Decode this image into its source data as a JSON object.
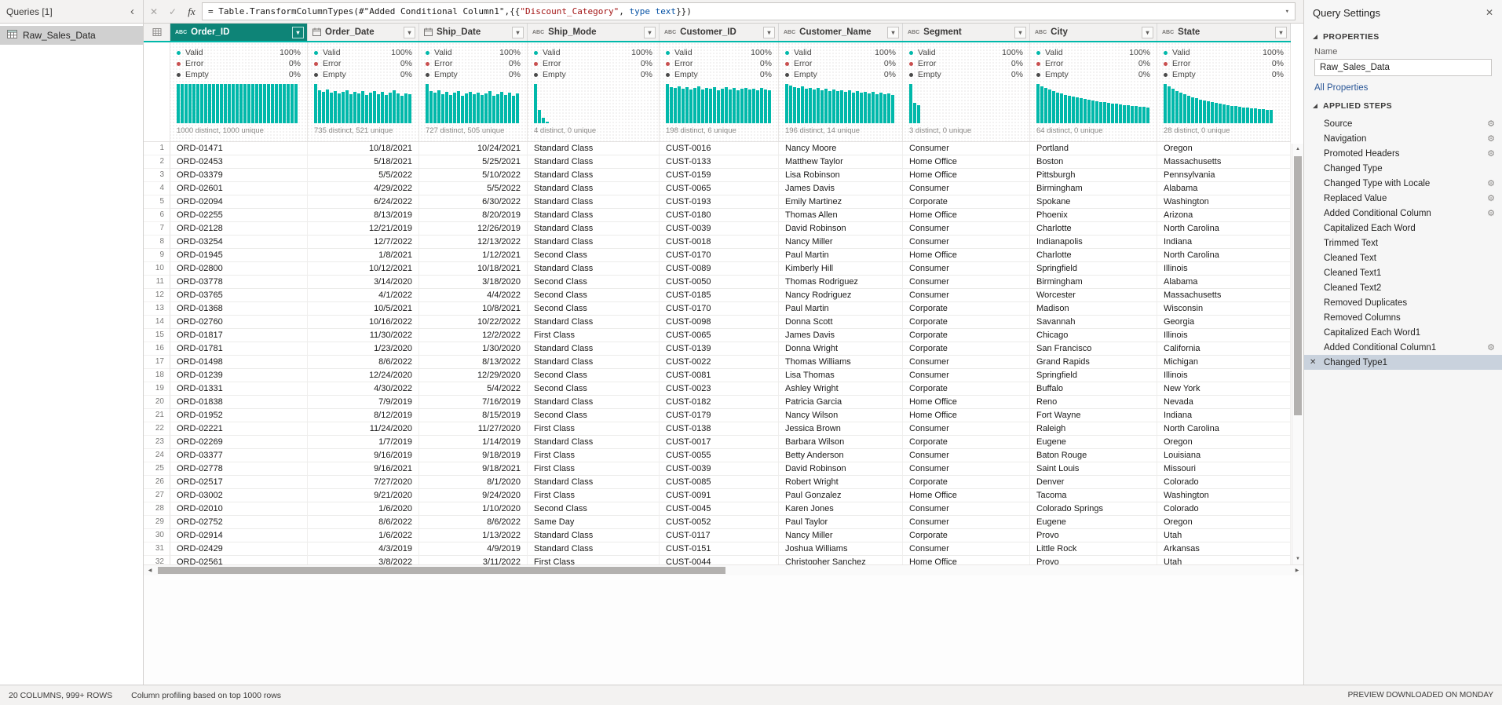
{
  "accent": "#01b8aa",
  "queries_pane": {
    "title": "Queries [1]",
    "items": [
      {
        "label": "Raw_Sales_Data",
        "selected": true
      }
    ]
  },
  "formula_bar": {
    "tokens": [
      {
        "text": "= Table.TransformColumnTypes(#\"Added Conditional Column1\",{{",
        "style": "plain"
      },
      {
        "text": "\"Discount_Category\"",
        "style": "string"
      },
      {
        "text": ", ",
        "style": "plain"
      },
      {
        "text": "type text",
        "style": "keyword"
      },
      {
        "text": "}})",
        "style": "plain"
      }
    ]
  },
  "table": {
    "quality_labels": {
      "valid": "Valid",
      "error": "Error",
      "empty": "Empty"
    },
    "columns": [
      {
        "name": "Order_ID",
        "type": "text",
        "selected": true,
        "quality": {
          "valid": "100%",
          "error": "0%",
          "empty": "0%"
        },
        "distinct_label": "1000 distinct, 1000 unique",
        "histogram": [
          1,
          1,
          1,
          1,
          1,
          1,
          1,
          1,
          1,
          1,
          1,
          1,
          1,
          1,
          1,
          1,
          1,
          1,
          1,
          1,
          1,
          1,
          1,
          1,
          1,
          1,
          1,
          1,
          1,
          1,
          1
        ]
      },
      {
        "name": "Order_Date",
        "type": "date",
        "selected": false,
        "quality": {
          "valid": "100%",
          "error": "0%",
          "empty": "0%"
        },
        "distinct_label": "735 distinct, 521 unique",
        "histogram": [
          1,
          0.84,
          0.8,
          0.86,
          0.78,
          0.83,
          0.76,
          0.81,
          0.85,
          0.74,
          0.8,
          0.77,
          0.83,
          0.72,
          0.78,
          0.82,
          0.75,
          0.8,
          0.73,
          0.79,
          0.84,
          0.76,
          0.71,
          0.77,
          0.74
        ]
      },
      {
        "name": "Ship_Date",
        "type": "date",
        "selected": false,
        "quality": {
          "valid": "100%",
          "error": "0%",
          "empty": "0%"
        },
        "distinct_label": "727 distinct, 505 unique",
        "histogram": [
          1,
          0.82,
          0.78,
          0.84,
          0.75,
          0.8,
          0.73,
          0.79,
          0.83,
          0.71,
          0.77,
          0.81,
          0.74,
          0.79,
          0.72,
          0.76,
          0.82,
          0.7,
          0.75,
          0.8,
          0.73,
          0.78,
          0.71,
          0.76
        ]
      },
      {
        "name": "Ship_Mode",
        "type": "text",
        "selected": false,
        "quality": {
          "valid": "100%",
          "error": "0%",
          "empty": "0%"
        },
        "distinct_label": "4 distinct, 0 unique",
        "histogram": [
          1,
          0.34,
          0.15,
          0.05
        ]
      },
      {
        "name": "Customer_ID",
        "type": "text",
        "selected": false,
        "quality": {
          "valid": "100%",
          "error": "0%",
          "empty": "0%"
        },
        "distinct_label": "198 distinct, 6 unique",
        "histogram": [
          1,
          0.93,
          0.9,
          0.95,
          0.88,
          0.92,
          0.87,
          0.91,
          0.94,
          0.86,
          0.9,
          0.88,
          0.92,
          0.85,
          0.89,
          0.93,
          0.87,
          0.9,
          0.84,
          0.88,
          0.91,
          0.86,
          0.89,
          0.85,
          0.9,
          0.87,
          0.84
        ]
      },
      {
        "name": "Customer_Name",
        "type": "text",
        "selected": false,
        "quality": {
          "valid": "100%",
          "error": "0%",
          "empty": "0%"
        },
        "distinct_label": "196 distinct, 14 unique",
        "histogram": [
          1,
          0.96,
          0.93,
          0.9,
          0.94,
          0.88,
          0.91,
          0.86,
          0.9,
          0.84,
          0.88,
          0.83,
          0.87,
          0.82,
          0.85,
          0.8,
          0.84,
          0.79,
          0.82,
          0.78,
          0.81,
          0.76,
          0.8,
          0.75,
          0.78,
          0.74,
          0.77,
          0.73
        ]
      },
      {
        "name": "Segment",
        "type": "text",
        "selected": false,
        "quality": {
          "valid": "100%",
          "error": "0%",
          "empty": "0%"
        },
        "distinct_label": "3 distinct, 0 unique",
        "histogram": [
          1,
          0.52,
          0.46
        ]
      },
      {
        "name": "City",
        "type": "text",
        "selected": false,
        "quality": {
          "valid": "100%",
          "error": "0%",
          "empty": "0%"
        },
        "distinct_label": "64 distinct, 0 unique",
        "histogram": [
          1,
          0.95,
          0.9,
          0.86,
          0.82,
          0.79,
          0.76,
          0.73,
          0.7,
          0.68,
          0.66,
          0.64,
          0.62,
          0.6,
          0.58,
          0.57,
          0.55,
          0.54,
          0.52,
          0.51,
          0.5,
          0.48,
          0.47,
          0.46,
          0.45,
          0.44,
          0.43,
          0.42,
          0.41
        ]
      },
      {
        "name": "State",
        "type": "text",
        "selected": false,
        "quality": {
          "valid": "100%",
          "error": "0%",
          "empty": "0%"
        },
        "distinct_label": "28 distinct, 0 unique",
        "histogram": [
          1,
          0.94,
          0.88,
          0.83,
          0.78,
          0.74,
          0.7,
          0.67,
          0.64,
          0.61,
          0.58,
          0.56,
          0.54,
          0.52,
          0.5,
          0.48,
          0.47,
          0.45,
          0.44,
          0.42,
          0.41,
          0.4,
          0.39,
          0.38,
          0.37,
          0.36,
          0.35,
          0.34
        ]
      }
    ],
    "rows": [
      [
        "ORD-01471",
        "10/18/2021",
        "10/24/2021",
        "Standard Class",
        "CUST-0016",
        "Nancy Moore",
        "Consumer",
        "Portland",
        "Oregon"
      ],
      [
        "ORD-02453",
        "5/18/2021",
        "5/25/2021",
        "Standard Class",
        "CUST-0133",
        "Matthew Taylor",
        "Home Office",
        "Boston",
        "Massachusetts"
      ],
      [
        "ORD-03379",
        "5/5/2022",
        "5/10/2022",
        "Standard Class",
        "CUST-0159",
        "Lisa Robinson",
        "Home Office",
        "Pittsburgh",
        "Pennsylvania"
      ],
      [
        "ORD-02601",
        "4/29/2022",
        "5/5/2022",
        "Standard Class",
        "CUST-0065",
        "James Davis",
        "Consumer",
        "Birmingham",
        "Alabama"
      ],
      [
        "ORD-02094",
        "6/24/2022",
        "6/30/2022",
        "Standard Class",
        "CUST-0193",
        "Emily Martinez",
        "Corporate",
        "Spokane",
        "Washington"
      ],
      [
        "ORD-02255",
        "8/13/2019",
        "8/20/2019",
        "Standard Class",
        "CUST-0180",
        "Thomas Allen",
        "Home Office",
        "Phoenix",
        "Arizona"
      ],
      [
        "ORD-02128",
        "12/21/2019",
        "12/26/2019",
        "Standard Class",
        "CUST-0039",
        "David Robinson",
        "Consumer",
        "Charlotte",
        "North Carolina"
      ],
      [
        "ORD-03254",
        "12/7/2022",
        "12/13/2022",
        "Standard Class",
        "CUST-0018",
        "Nancy Miller",
        "Consumer",
        "Indianapolis",
        "Indiana"
      ],
      [
        "ORD-01945",
        "1/8/2021",
        "1/12/2021",
        "Second Class",
        "CUST-0170",
        "Paul Martin",
        "Home Office",
        "Charlotte",
        "North Carolina"
      ],
      [
        "ORD-02800",
        "10/12/2021",
        "10/18/2021",
        "Standard Class",
        "CUST-0089",
        "Kimberly Hill",
        "Consumer",
        "Springfield",
        "Illinois"
      ],
      [
        "ORD-03778",
        "3/14/2020",
        "3/18/2020",
        "Second Class",
        "CUST-0050",
        "Thomas Rodriguez",
        "Consumer",
        "Birmingham",
        "Alabama"
      ],
      [
        "ORD-03765",
        "4/1/2022",
        "4/4/2022",
        "Second Class",
        "CUST-0185",
        "Nancy Rodriguez",
        "Consumer",
        "Worcester",
        "Massachusetts"
      ],
      [
        "ORD-01368",
        "10/5/2021",
        "10/8/2021",
        "Second Class",
        "CUST-0170",
        "Paul Martin",
        "Corporate",
        "Madison",
        "Wisconsin"
      ],
      [
        "ORD-02760",
        "10/16/2022",
        "10/22/2022",
        "Standard Class",
        "CUST-0098",
        "Donna Scott",
        "Corporate",
        "Savannah",
        "Georgia"
      ],
      [
        "ORD-01817",
        "11/30/2022",
        "12/2/2022",
        "First Class",
        "CUST-0065",
        "James Davis",
        "Corporate",
        "Chicago",
        "Illinois"
      ],
      [
        "ORD-01781",
        "1/23/2020",
        "1/30/2020",
        "Standard Class",
        "CUST-0139",
        "Donna Wright",
        "Corporate",
        "San Francisco",
        "California"
      ],
      [
        "ORD-01498",
        "8/6/2022",
        "8/13/2022",
        "Standard Class",
        "CUST-0022",
        "Thomas Williams",
        "Consumer",
        "Grand Rapids",
        "Michigan"
      ],
      [
        "ORD-01239",
        "12/24/2020",
        "12/29/2020",
        "Second Class",
        "CUST-0081",
        "Lisa Thomas",
        "Consumer",
        "Springfield",
        "Illinois"
      ],
      [
        "ORD-01331",
        "4/30/2022",
        "5/4/2022",
        "Second Class",
        "CUST-0023",
        "Ashley Wright",
        "Corporate",
        "Buffalo",
        "New York"
      ],
      [
        "ORD-01838",
        "7/9/2019",
        "7/16/2019",
        "Standard Class",
        "CUST-0182",
        "Patricia Garcia",
        "Home Office",
        "Reno",
        "Nevada"
      ],
      [
        "ORD-01952",
        "8/12/2019",
        "8/15/2019",
        "Second Class",
        "CUST-0179",
        "Nancy Wilson",
        "Home Office",
        "Fort Wayne",
        "Indiana"
      ],
      [
        "ORD-02221",
        "11/24/2020",
        "11/27/2020",
        "First Class",
        "CUST-0138",
        "Jessica Brown",
        "Consumer",
        "Raleigh",
        "North Carolina"
      ],
      [
        "ORD-02269",
        "1/7/2019",
        "1/14/2019",
        "Standard Class",
        "CUST-0017",
        "Barbara Wilson",
        "Corporate",
        "Eugene",
        "Oregon"
      ],
      [
        "ORD-03377",
        "9/16/2019",
        "9/18/2019",
        "First Class",
        "CUST-0055",
        "Betty Anderson",
        "Consumer",
        "Baton Rouge",
        "Louisiana"
      ],
      [
        "ORD-02778",
        "9/16/2021",
        "9/18/2021",
        "First Class",
        "CUST-0039",
        "David Robinson",
        "Consumer",
        "Saint Louis",
        "Missouri"
      ],
      [
        "ORD-02517",
        "7/27/2020",
        "8/1/2020",
        "Standard Class",
        "CUST-0085",
        "Robert Wright",
        "Corporate",
        "Denver",
        "Colorado"
      ],
      [
        "ORD-03002",
        "9/21/2020",
        "9/24/2020",
        "First Class",
        "CUST-0091",
        "Paul Gonzalez",
        "Home Office",
        "Tacoma",
        "Washington"
      ],
      [
        "ORD-02010",
        "1/6/2020",
        "1/10/2020",
        "Second Class",
        "CUST-0045",
        "Karen Jones",
        "Consumer",
        "Colorado Springs",
        "Colorado"
      ],
      [
        "ORD-02752",
        "8/6/2022",
        "8/6/2022",
        "Same Day",
        "CUST-0052",
        "Paul Taylor",
        "Consumer",
        "Eugene",
        "Oregon"
      ],
      [
        "ORD-02914",
        "1/6/2022",
        "1/13/2022",
        "Standard Class",
        "CUST-0117",
        "Nancy Miller",
        "Corporate",
        "Provo",
        "Utah"
      ],
      [
        "ORD-02429",
        "4/3/2019",
        "4/9/2019",
        "Standard Class",
        "CUST-0151",
        "Joshua Williams",
        "Consumer",
        "Little Rock",
        "Arkansas"
      ],
      [
        "ORD-02561",
        "3/8/2022",
        "3/11/2022",
        "First Class",
        "CUST-0044",
        "Christopher Sanchez",
        "Home Office",
        "Provo",
        "Utah"
      ]
    ]
  },
  "settings_pane": {
    "title": "Query Settings",
    "properties_label": "PROPERTIES",
    "name_label": "Name",
    "name_value": "Raw_Sales_Data",
    "all_properties_label": "All Properties",
    "applied_steps_label": "APPLIED STEPS",
    "steps": [
      {
        "label": "Source",
        "gear": true
      },
      {
        "label": "Navigation",
        "gear": true
      },
      {
        "label": "Promoted Headers",
        "gear": true
      },
      {
        "label": "Changed Type",
        "gear": false
      },
      {
        "label": "Changed Type with Locale",
        "gear": true
      },
      {
        "label": "Replaced Value",
        "gear": true
      },
      {
        "label": "Added Conditional Column",
        "gear": true
      },
      {
        "label": "Capitalized Each Word",
        "gear": false
      },
      {
        "label": "Trimmed Text",
        "gear": false
      },
      {
        "label": "Cleaned Text",
        "gear": false
      },
      {
        "label": "Cleaned Text1",
        "gear": false
      },
      {
        "label": "Cleaned Text2",
        "gear": false
      },
      {
        "label": "Removed Duplicates",
        "gear": false
      },
      {
        "label": "Removed Columns",
        "gear": false
      },
      {
        "label": "Capitalized Each Word1",
        "gear": false
      },
      {
        "label": "Added Conditional Column1",
        "gear": true
      },
      {
        "label": "Changed Type1",
        "gear": false,
        "selected": true
      }
    ]
  },
  "status_bar": {
    "columns_info": "20 COLUMNS, 999+ ROWS",
    "profiling_info": "Column profiling based on top 1000 rows",
    "preview_info": "PREVIEW DOWNLOADED ON MONDAY"
  }
}
